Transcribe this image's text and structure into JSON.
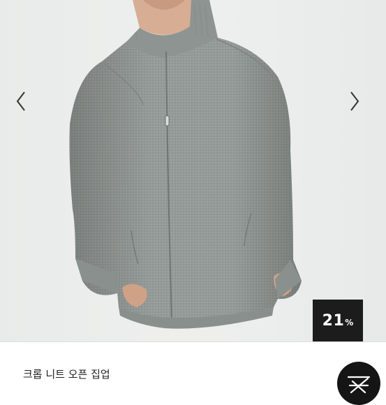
{
  "product": {
    "title": "크롭 니트 오픈 집업",
    "discount_value": "21",
    "discount_unit": "%"
  },
  "gallery": {
    "prev_icon": "chevron-left-icon",
    "next_icon": "chevron-right-icon"
  },
  "colors": {
    "badge_background": "#1c1c1c",
    "badge_text": "#ffffff",
    "knit_gray": "#949a97"
  }
}
